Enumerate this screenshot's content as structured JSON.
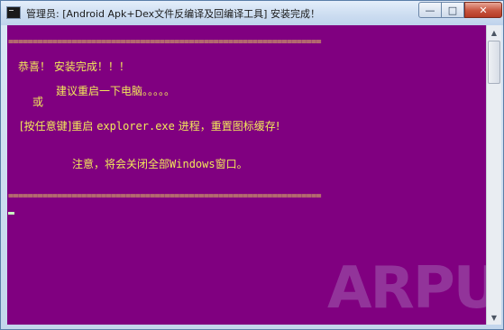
{
  "window": {
    "title": "管理员:  [Android Apk+Dex文件反编译及回编译工具] 安装完成！",
    "icon": "console-icon",
    "minimize_glyph": "—",
    "maximize_glyph": "□",
    "close_glyph": "✕"
  },
  "console": {
    "background": "#800080",
    "text_color": "#f2e85a",
    "separator": "================================================================",
    "line1": "恭喜！ 安装完成！！！",
    "line2": "建议重启一下电脑。。。。。",
    "line3": "或",
    "line4_prefix": "[按任意键]重启 ",
    "line4_cmd": "explorer.exe",
    "line4_suffix": " 进程，重置图标缓存!",
    "line5_prefix": "注意，将会关闭全部",
    "line5_word": "Windows",
    "line5_suffix": "窗口。"
  },
  "watermark": {
    "text": "ARPUN"
  },
  "scrollbar": {
    "up_glyph": "▲",
    "down_glyph": "▼"
  }
}
